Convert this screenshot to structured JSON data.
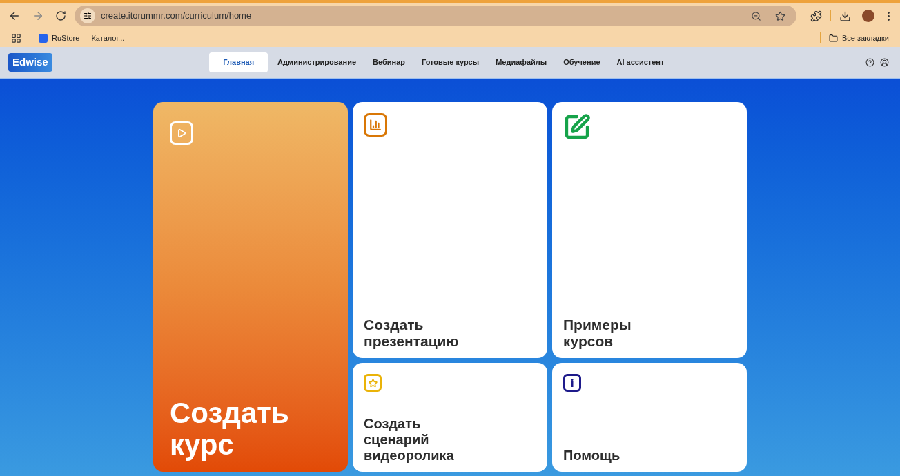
{
  "browser": {
    "url": "create.itorummr.com/curriculum/home",
    "bookmarks": [
      {
        "label": "RuStore — Каталог..."
      }
    ],
    "all_bookmarks": "Все закладки"
  },
  "app": {
    "logo": "Edwise",
    "nav": [
      {
        "label": "Главная",
        "selected": true
      },
      {
        "label": "Администрирование",
        "selected": false
      },
      {
        "label": "Вебинар",
        "selected": false
      },
      {
        "label": "Готовые курсы",
        "selected": false
      },
      {
        "label": "Медиафайлы",
        "selected": false
      },
      {
        "label": "Обучение",
        "selected": false
      },
      {
        "label": "AI ассистент",
        "selected": false
      }
    ]
  },
  "cards": [
    {
      "kind": "hero",
      "title": "Создать\nкурс"
    },
    {
      "kind": "tall",
      "title": "Создать\nпрезентацию"
    },
    {
      "kind": "tall",
      "title": "Примеры\nкурсов"
    },
    {
      "kind": "short",
      "title": "Создать\nсценарий\nвидеоролика"
    },
    {
      "kind": "short",
      "title": "Помощь"
    }
  ]
}
